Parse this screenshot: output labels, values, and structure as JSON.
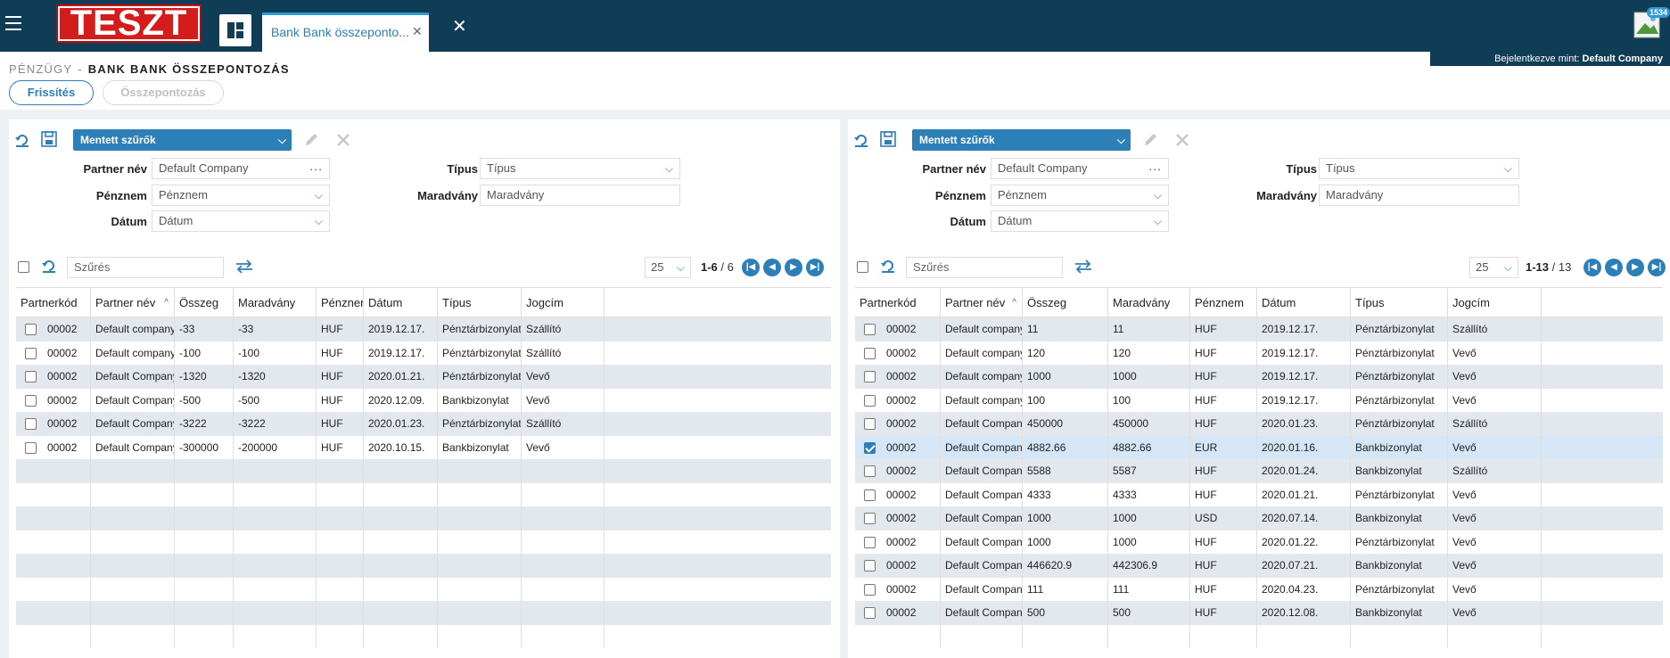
{
  "header": {
    "logo_text": "TESZT",
    "tab_label": "Bank Bank összeponto...",
    "tab_close": "✕",
    "top_close": "✕",
    "badge": "1534",
    "login_label": "Bejelentkezve mint:",
    "login_user": "Default Company"
  },
  "breadcrumb": {
    "parent": "PÉNZÜGY",
    "sep": "-",
    "current": "BANK BANK ÖSSZEPONTOZÁS"
  },
  "actions": {
    "refresh": "Frissítés",
    "match": "Összepontozás"
  },
  "filters": {
    "saved": "Mentett szűrők",
    "partner_label": "Partner név",
    "partner_value": "Default Company",
    "currency_label": "Pénznem",
    "currency_value": "Pénznem",
    "date_label": "Dátum",
    "date_value": "Dátum",
    "type_label": "Típus",
    "type_value": "Típus",
    "remaining_label": "Maradvány",
    "remaining_value": "Maradvány",
    "dots": "..."
  },
  "search": {
    "placeholder": "Szűrés",
    "page_size": "25"
  },
  "left": {
    "pagination": {
      "range": "1-6",
      "total": "/ 6"
    },
    "columns": [
      "Partnerkód",
      "Partner név",
      "Összeg",
      "Maradvány",
      "Pénznem",
      "Dátum",
      "Típus",
      "Jogcím"
    ],
    "rows": [
      [
        "00002",
        "Default company",
        "-33",
        "-33",
        "HUF",
        "2019.12.17.",
        "Pénztárbizonylat",
        "Szállító"
      ],
      [
        "00002",
        "Default company",
        "-100",
        "-100",
        "HUF",
        "2019.12.17.",
        "Pénztárbizonylat",
        "Szállító"
      ],
      [
        "00002",
        "Default Company",
        "-1320",
        "-1320",
        "HUF",
        "2020.01.21.",
        "Pénztárbizonylat",
        "Vevő"
      ],
      [
        "00002",
        "Default Company",
        "-500",
        "-500",
        "HUF",
        "2020.12.09.",
        "Bankbizonylat",
        "Vevő"
      ],
      [
        "00002",
        "Default Company",
        "-3222",
        "-3222",
        "HUF",
        "2020.01.23.",
        "Pénztárbizonylat",
        "Szállító"
      ],
      [
        "00002",
        "Default Company",
        "-300000",
        "-200000",
        "HUF",
        "2020.10.15.",
        "Bankbizonylat",
        "Vevő"
      ]
    ]
  },
  "right": {
    "pagination": {
      "range": "1-13",
      "total": "/ 13"
    },
    "columns": [
      "Partnerkód",
      "Partner név",
      "Összeg",
      "Maradvány",
      "Pénznem",
      "Dátum",
      "Típus",
      "Jogcím"
    ],
    "rows": [
      [
        "00002",
        "Default company",
        "11",
        "11",
        "HUF",
        "2019.12.17.",
        "Pénztárbizonylat",
        "Szállító"
      ],
      [
        "00002",
        "Default company",
        "120",
        "120",
        "HUF",
        "2019.12.17.",
        "Pénztárbizonylat",
        "Vevő"
      ],
      [
        "00002",
        "Default company",
        "1000",
        "1000",
        "HUF",
        "2019.12.17.",
        "Pénztárbizonylat",
        "Vevő"
      ],
      [
        "00002",
        "Default company",
        "100",
        "100",
        "HUF",
        "2019.12.17.",
        "Pénztárbizonylat",
        "Vevő"
      ],
      [
        "00002",
        "Default Company",
        "450000",
        "450000",
        "HUF",
        "2020.01.23.",
        "Pénztárbizonylat",
        "Szállító"
      ],
      [
        "00002",
        "Default Company",
        "4882.66",
        "4882.66",
        "EUR",
        "2020.01.16.",
        "Bankbizonylat",
        "Vevő"
      ],
      [
        "00002",
        "Default Company",
        "5588",
        "5587",
        "HUF",
        "2020.01.24.",
        "Bankbizonylat",
        "Szállító"
      ],
      [
        "00002",
        "Default Company",
        "4333",
        "4333",
        "HUF",
        "2020.01.21.",
        "Pénztárbizonylat",
        "Vevő"
      ],
      [
        "00002",
        "Default Company",
        "1000",
        "1000",
        "USD",
        "2020.07.14.",
        "Bankbizonylat",
        "Vevő"
      ],
      [
        "00002",
        "Default Company",
        "1000",
        "1000",
        "HUF",
        "2020.01.22.",
        "Pénztárbizonylat",
        "Vevő"
      ],
      [
        "00002",
        "Default Company",
        "446620.9",
        "442306.9",
        "HUF",
        "2020.07.21.",
        "Bankbizonylat",
        "Vevő"
      ],
      [
        "00002",
        "Default Company",
        "111",
        "111",
        "HUF",
        "2020.04.23.",
        "Pénztárbizonylat",
        "Vevő"
      ],
      [
        "00002",
        "Default Company",
        "500",
        "500",
        "HUF",
        "2020.12.08.",
        "Bankbizonylat",
        "Vevő"
      ]
    ],
    "checked_row": 5
  },
  "colors": {
    "topbar": "#0f3d56",
    "accent": "#2d7fb8",
    "logo_red": "#d41c1c"
  }
}
